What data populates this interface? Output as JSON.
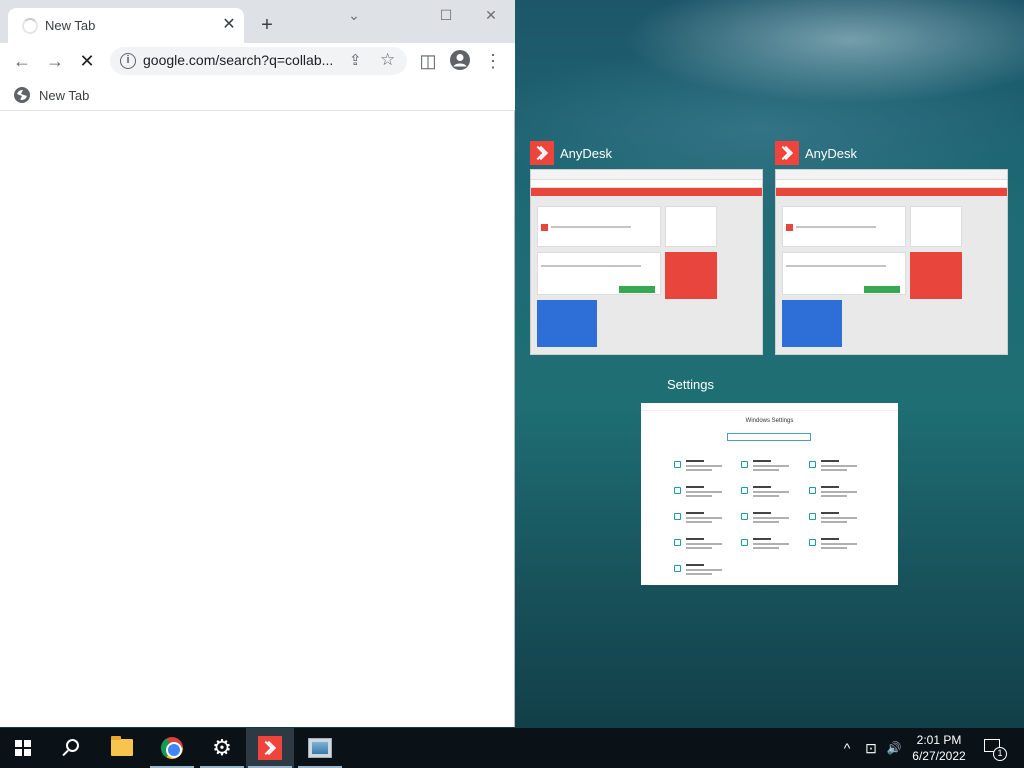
{
  "browser": {
    "tab": {
      "title": "New Tab",
      "close": "✕"
    },
    "new_tab": "+",
    "window_controls": {
      "minimize": "⌄",
      "maximize": "☐",
      "close": "✕"
    },
    "toolbar": {
      "back": "←",
      "forward": "→",
      "stop": "✕"
    },
    "omnibox": {
      "info": "i",
      "url": "google.com/search?q=collab...",
      "share": "⇪",
      "star": "☆"
    },
    "actions": {
      "side_panel": "◫",
      "profile": "●",
      "menu": "⋮"
    },
    "bookmarks": [
      {
        "label": "New Tab",
        "icon": "globe-icon"
      }
    ]
  },
  "task_view": {
    "windows": [
      {
        "app": "AnyDesk",
        "icon": "anydesk-icon"
      },
      {
        "app": "AnyDesk",
        "icon": "anydesk-icon"
      },
      {
        "app": "Settings"
      }
    ],
    "settings_thumb": {
      "heading": "Windows Settings"
    }
  },
  "taskbar": {
    "icons": [
      {
        "name": "start-button"
      },
      {
        "name": "search-button"
      },
      {
        "name": "file-explorer"
      },
      {
        "name": "chrome"
      },
      {
        "name": "settings"
      },
      {
        "name": "anydesk"
      },
      {
        "name": "task-view-app"
      }
    ],
    "tray": {
      "chevron": "^",
      "network": "⊡",
      "volume": "🔊"
    },
    "time": "2:01 PM",
    "date": "6/27/2022",
    "notification_count": "1"
  },
  "colors": {
    "anydesk_red": "#ef443b",
    "taskbar_bg": "#0a1218",
    "chrome_tabstrip": "#dee1e6"
  }
}
